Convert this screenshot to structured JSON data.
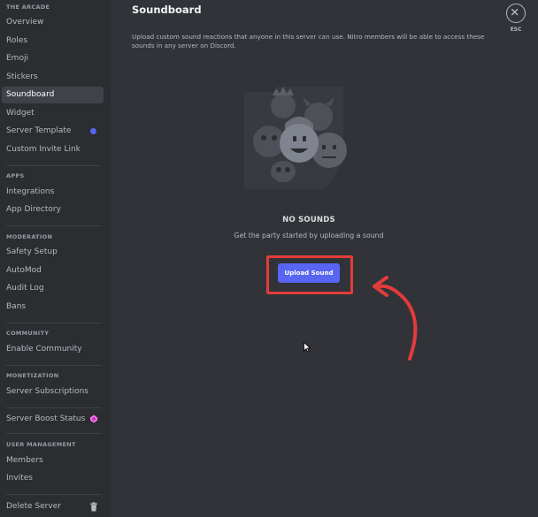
{
  "sidebar": {
    "server_name": "THE ARCADE",
    "sections": [
      {
        "header": "APPS"
      },
      {
        "header": "MODERATION"
      },
      {
        "header": "COMMUNITY"
      },
      {
        "header": "MONETIZATION"
      },
      {
        "header": "USER MANAGEMENT"
      }
    ],
    "items": {
      "overview": "Overview",
      "roles": "Roles",
      "emoji": "Emoji",
      "stickers": "Stickers",
      "soundboard": "Soundboard",
      "widget": "Widget",
      "server_template": "Server Template",
      "custom_invite_link": "Custom Invite Link",
      "integrations": "Integrations",
      "app_directory": "App Directory",
      "safety_setup": "Safety Setup",
      "automod": "AutoMod",
      "audit_log": "Audit Log",
      "bans": "Bans",
      "enable_community": "Enable Community",
      "server_subscriptions": "Server Subscriptions",
      "server_boost_status": "Server Boost Status",
      "members": "Members",
      "invites": "Invites",
      "delete_server": "Delete Server"
    },
    "active_item": "Soundboard"
  },
  "main": {
    "title": "Soundboard",
    "description": "Upload custom sound reactions that anyone in this server can use. Nitro members will be able to access these sounds in any server on Discord.",
    "close_label": "ESC",
    "empty_title": "NO SOUNDS",
    "empty_subtitle": "Get the party started by uploading a sound",
    "upload_button": "Upload Sound"
  },
  "colors": {
    "accent": "#5865f2",
    "highlight": "#e33b3b",
    "boost": "#ff73fa"
  }
}
